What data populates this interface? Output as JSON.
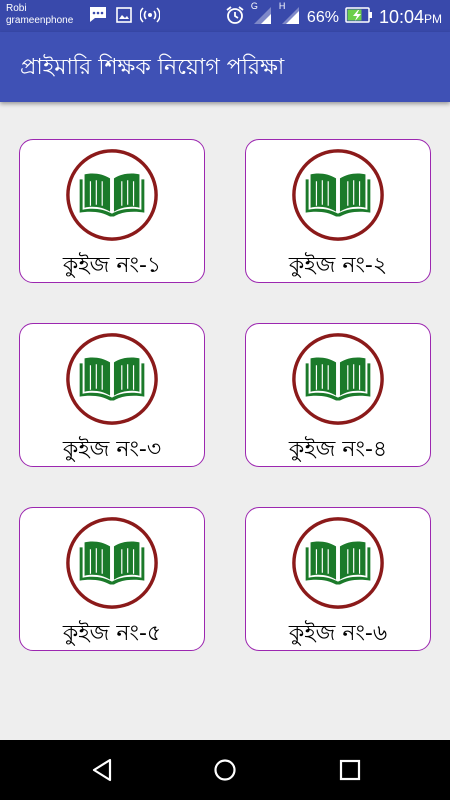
{
  "status_bar": {
    "carrier_line1": "Robi",
    "carrier_line2": "grameenphone",
    "network1_label": "G",
    "network2_label": "H",
    "battery_percent": "66%",
    "time": "10:04",
    "ampm": "PM",
    "icons": [
      "message-icon",
      "image-icon",
      "hotspot-icon",
      "alarm-icon",
      "signal-icon",
      "signal-icon",
      "battery-charging-icon"
    ]
  },
  "app_bar": {
    "title": "প্রাইমারি শিক্ষক নিয়োগ পরিক্ষা"
  },
  "quizzes": [
    {
      "label": "কুইজ নং-১",
      "icon": "book-icon"
    },
    {
      "label": "কুইজ নং-২",
      "icon": "book-icon"
    },
    {
      "label": "কুইজ নং-৩",
      "icon": "book-icon"
    },
    {
      "label": "কুইজ নং-৪",
      "icon": "book-icon"
    },
    {
      "label": "কুইজ নং-৫",
      "icon": "book-icon"
    },
    {
      "label": "কুইজ নং-৬",
      "icon": "book-icon"
    }
  ],
  "nav_bar": {
    "buttons": [
      "back-icon",
      "home-icon",
      "recents-icon"
    ]
  },
  "colors": {
    "status_bar": "#3949ab",
    "app_bar": "#3f51b5",
    "card_border": "#9c27b0",
    "logo_ring": "#8b1a1a",
    "book_green": "#1b7a2a",
    "background": "#eeeeee"
  }
}
